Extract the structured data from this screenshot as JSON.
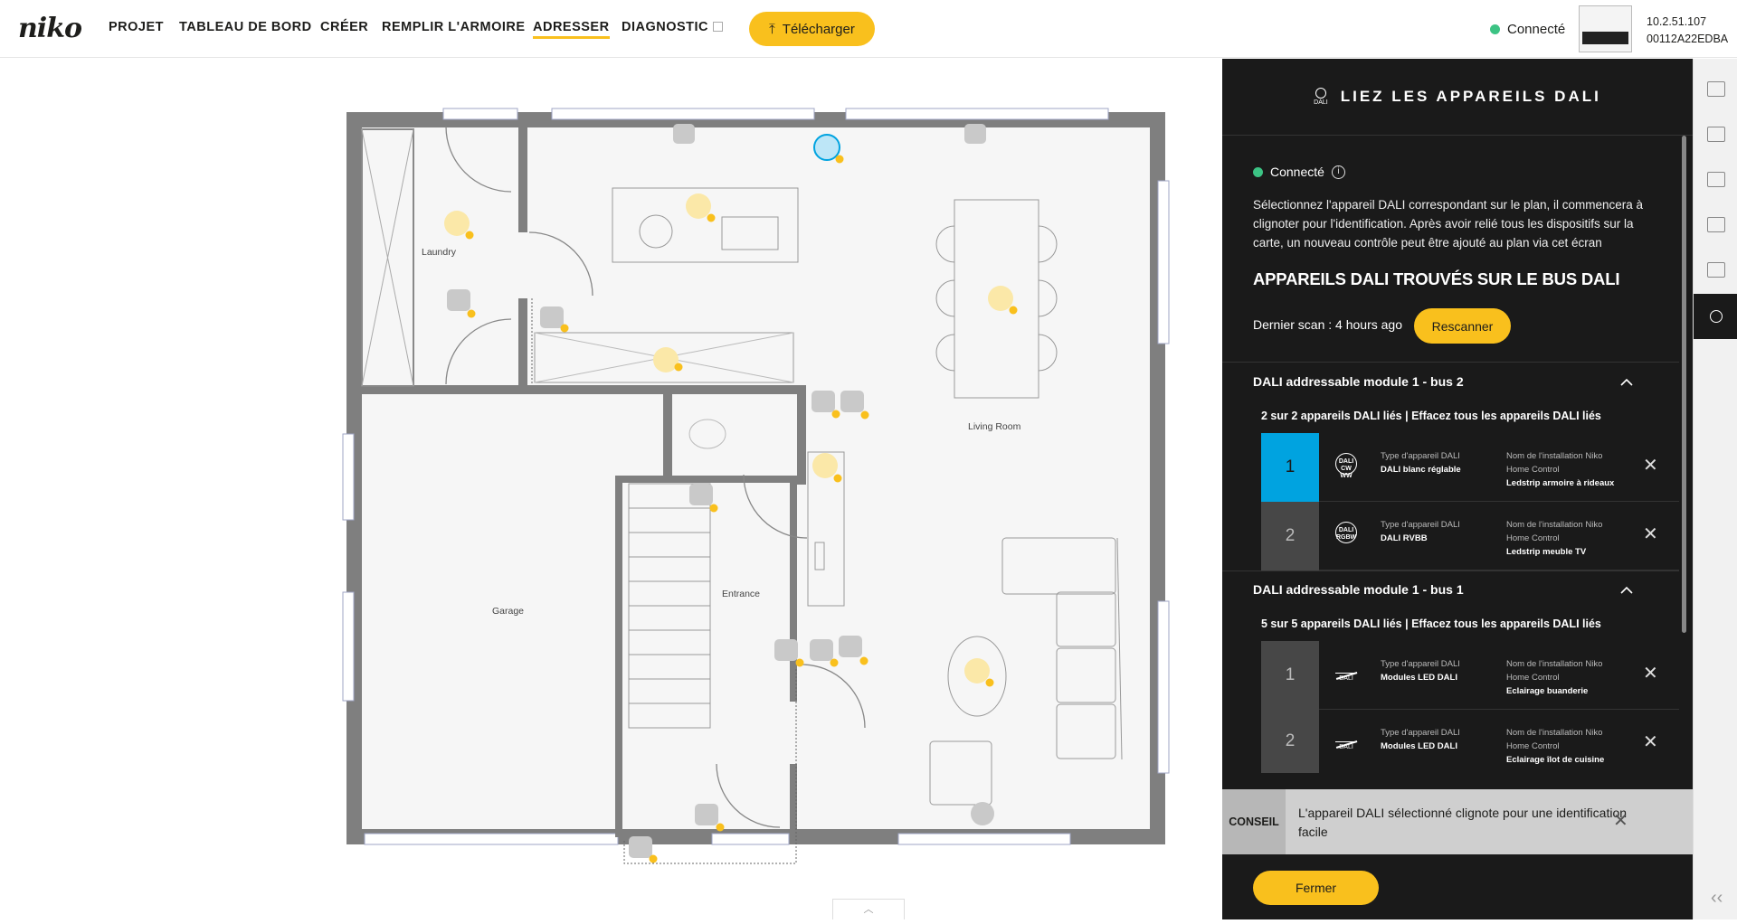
{
  "topbar": {
    "logo": "niko",
    "nav": [
      {
        "label": "PROJET",
        "active": false
      },
      {
        "label": "TABLEAU DE BORD",
        "active": false
      },
      {
        "label": "CRÉER",
        "active": false
      },
      {
        "label": "REMPLIR L'ARMOIRE",
        "active": false
      },
      {
        "label": "ADRESSER",
        "active": true
      },
      {
        "label": "DIAGNOSTIC",
        "active": false
      }
    ],
    "download_label": "Télécharger",
    "connection_status": "Connecté",
    "device_ip": "10.2.51.107",
    "device_id": "00112A22EDBA"
  },
  "floorplan": {
    "rooms": [
      "Laundry",
      "Living Room",
      "Garage",
      "Entrance"
    ]
  },
  "panel": {
    "icon_caption": "DALI",
    "title": "LIEZ LES APPAREILS DALI",
    "connection": "Connecté",
    "description": "Sélectionnez l'appareil DALI correspondant sur le plan, il commencera à clignoter pour l'identification. Après avoir relié tous les dispositifs sur la carte, un nouveau contrôle peut être ajouté au plan via cet écran",
    "found_title": "APPAREILS DALI TROUVÉS SUR LE BUS DALI",
    "last_scan": "Dernier scan : 4 hours ago",
    "rescan_label": "Rescanner",
    "type_label": "Type d'appareil DALI",
    "name_label": "Nom de l'installation Niko Home Control",
    "groups": [
      {
        "title": "DALI addressable module 1 - bus 2",
        "summary": "2 sur 2 appareils DALI liés | Effacez tous les appareils DALI liés",
        "rows": [
          {
            "num": "1",
            "icon_text": "DALI",
            "icon_sub": "CW WW",
            "type": "DALI blanc réglable",
            "name": "Ledstrip armoire à rideaux",
            "selected": true
          },
          {
            "num": "2",
            "icon_text": "DALI",
            "icon_sub": "RGBW",
            "type": "DALI RVBB",
            "name": "Ledstrip meuble TV",
            "selected": false
          }
        ]
      },
      {
        "title": "DALI addressable module 1 - bus 1",
        "summary": "5 sur 5 appareils DALI liés | Effacez tous les appareils DALI liés",
        "rows": [
          {
            "num": "1",
            "icon_text": "DALI",
            "type": "Modules LED DALI",
            "name": "Eclairage buanderie",
            "selected": false
          },
          {
            "num": "2",
            "icon_text": "DALI",
            "type": "Modules LED DALI",
            "name": "Eclairage îlot de cuisine",
            "selected": false
          }
        ]
      }
    ],
    "tip_label": "CONSEIL",
    "tip_text": "L'appareil DALI sélectionné clignote pour une identification facile",
    "close_label": "Fermer"
  },
  "colors": {
    "accent": "#f9c01d",
    "panel_bg": "#1a1a1a",
    "selected": "#00a3e0",
    "connected": "#3cc384"
  }
}
